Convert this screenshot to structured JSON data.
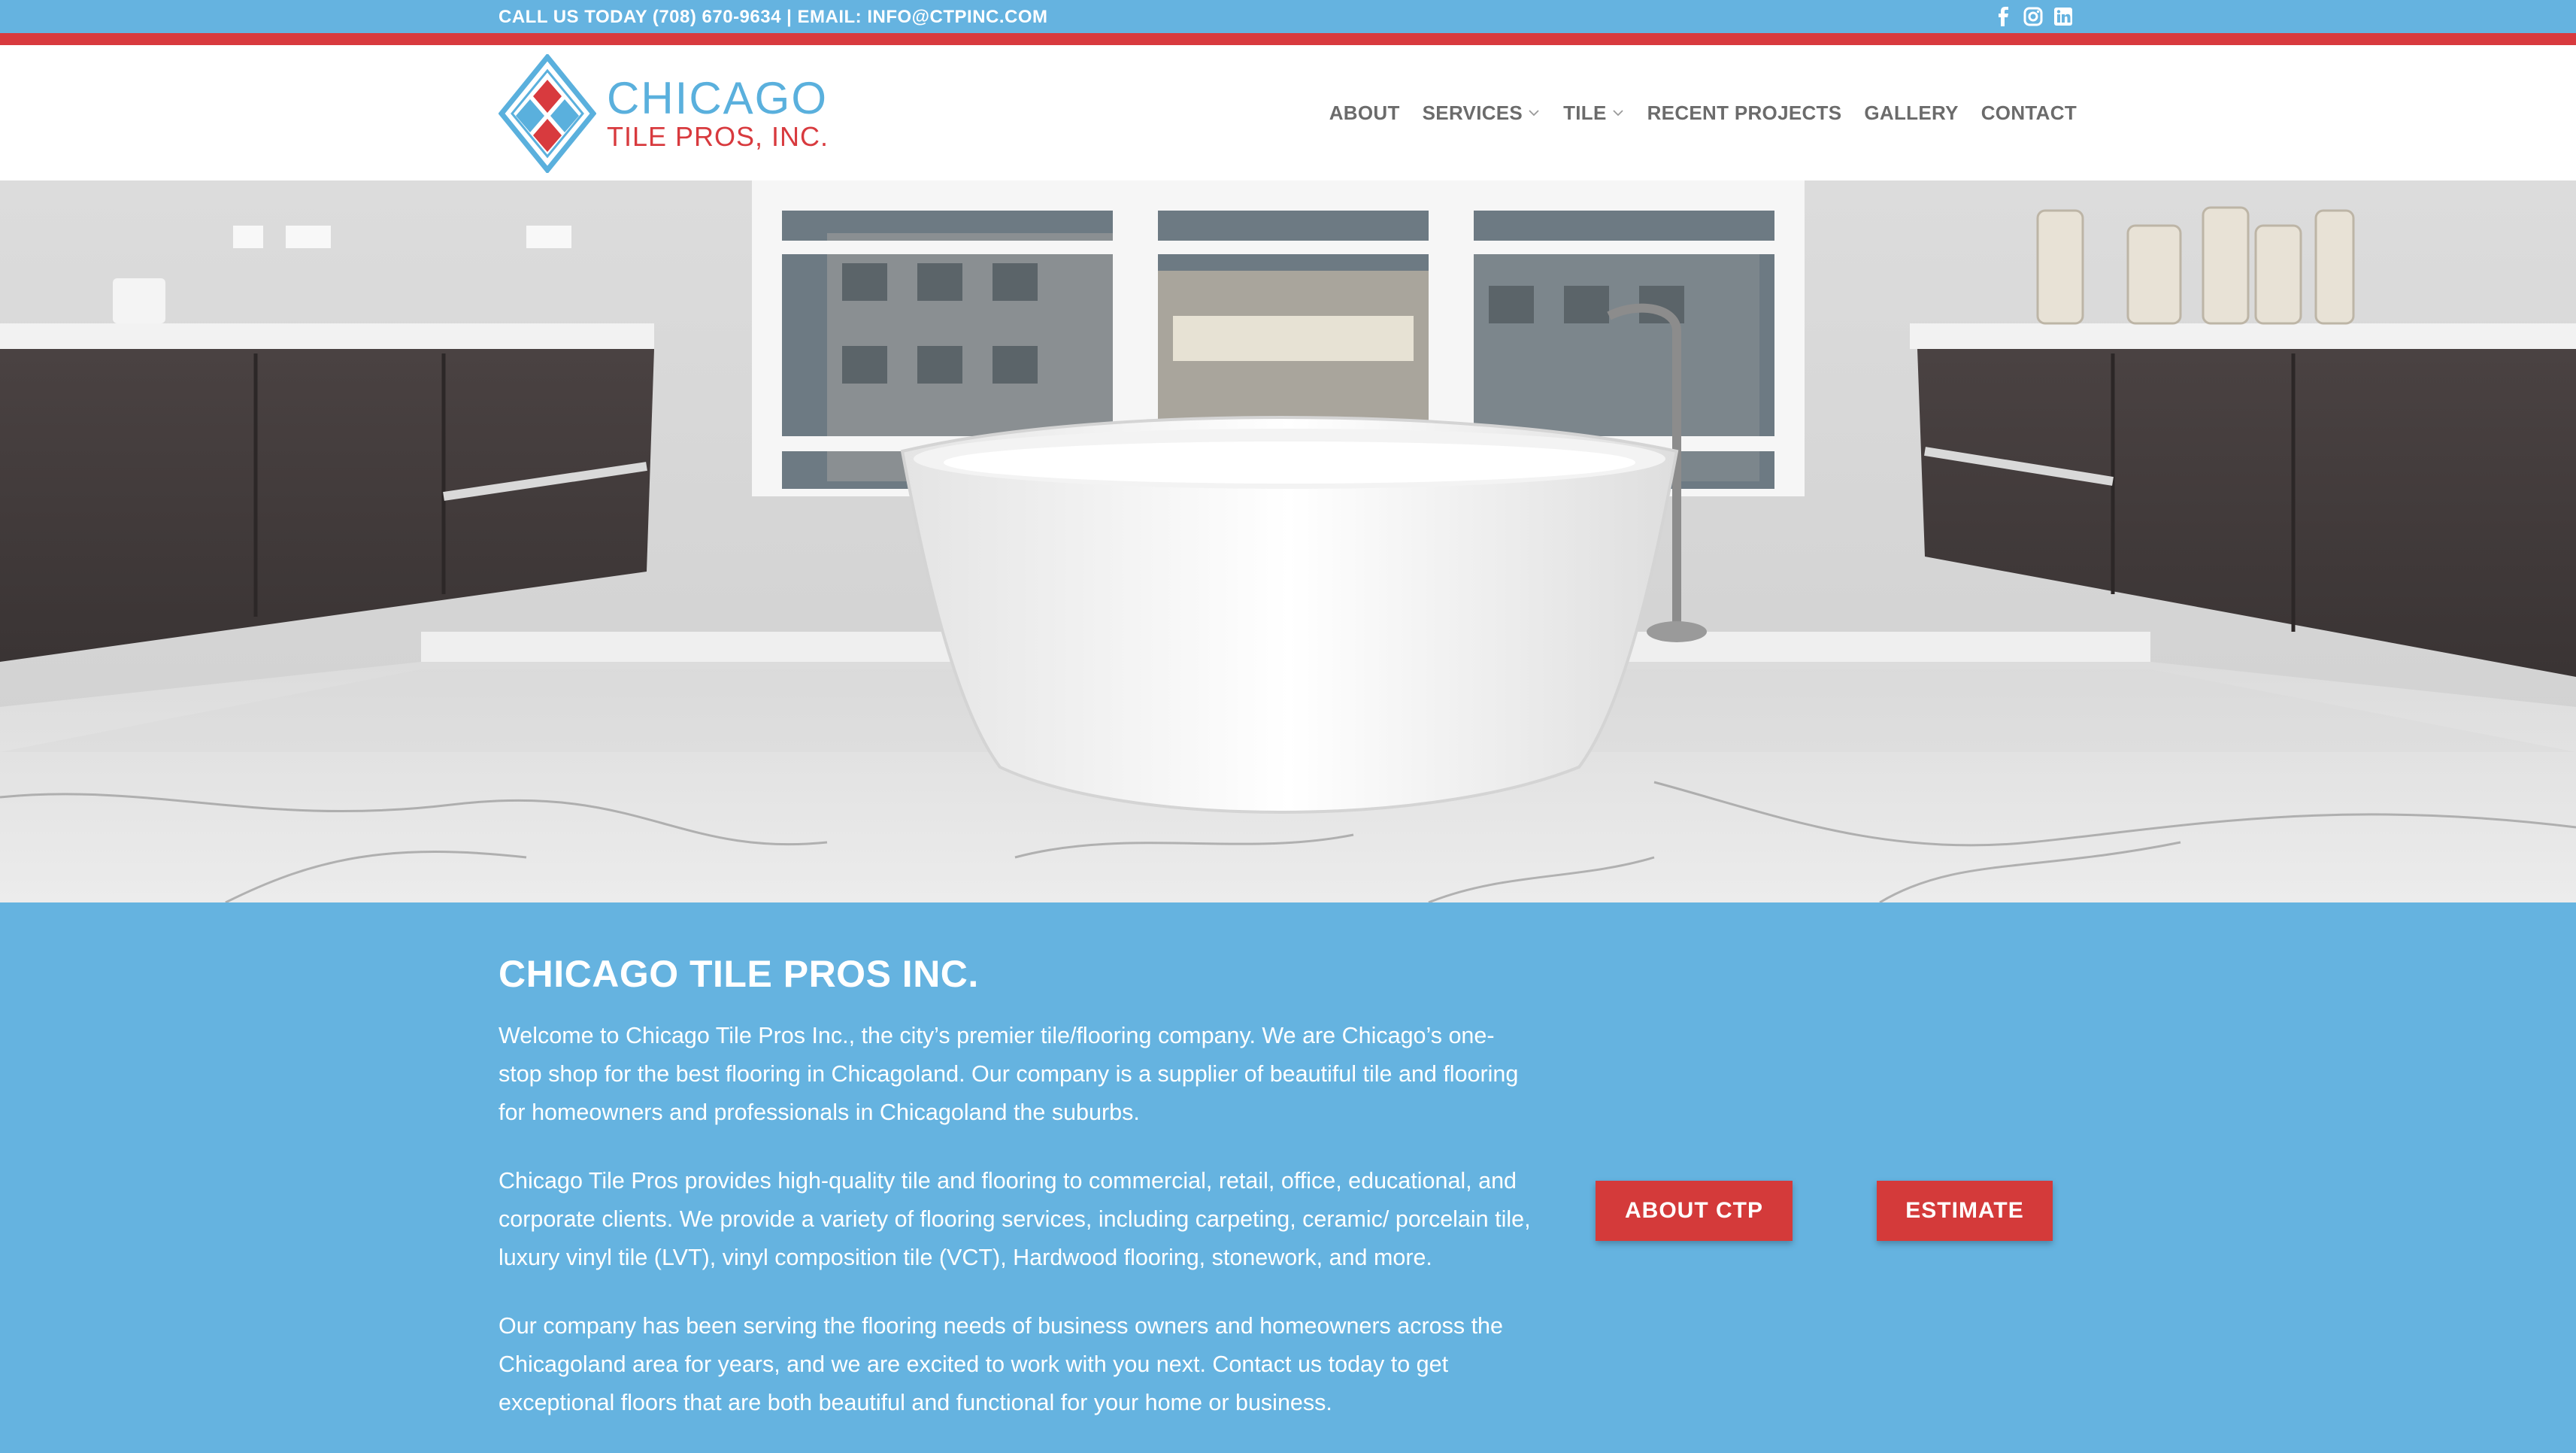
{
  "topbar": {
    "contact_text": "CALL US TODAY (708) 670-9634 | EMAIL: INFO@CTPINC.COM",
    "social_icons": [
      "facebook-icon",
      "instagram-icon",
      "linkedin-icon"
    ]
  },
  "header": {
    "logo_line1": "CHICAGO",
    "logo_line2": "TILE PROS, INC.",
    "nav": [
      {
        "label": "ABOUT",
        "has_dropdown": false
      },
      {
        "label": "SERVICES",
        "has_dropdown": true
      },
      {
        "label": "TILE",
        "has_dropdown": true
      },
      {
        "label": "RECENT PROJECTS",
        "has_dropdown": false
      },
      {
        "label": "GALLERY",
        "has_dropdown": false
      },
      {
        "label": "CONTACT",
        "has_dropdown": false
      }
    ]
  },
  "content": {
    "title": "CHICAGO TILE PROS INC.",
    "paragraphs": [
      "Welcome to Chicago Tile Pros Inc., the city’s premier tile/flooring company. We are Chicago’s one-stop shop for the best flooring in Chicagoland. Our company is a supplier of beautiful tile and flooring for homeowners and professionals in Chicagoland the suburbs.",
      "Chicago Tile Pros provides high-quality tile and flooring to commercial, retail, office, educational, and corporate clients. We provide a variety of flooring services, including carpeting, ceramic/ porcelain tile, luxury vinyl tile (LVT), vinyl composition tile (VCT), Hardwood flooring, stonework, and more.",
      "Our company has been serving the flooring needs of business owners and homeowners across the Chicagoland area for years, and we are excited to work with you next. Contact us today to get exceptional floors that are both beautiful and functional for your home or business."
    ],
    "buttons": {
      "about": "ABOUT CTP",
      "estimate": "ESTIMATE"
    }
  },
  "colors": {
    "brand_blue": "#65b3e0",
    "brand_red": "#d83a3e",
    "nav_text": "#6b6b6b"
  }
}
